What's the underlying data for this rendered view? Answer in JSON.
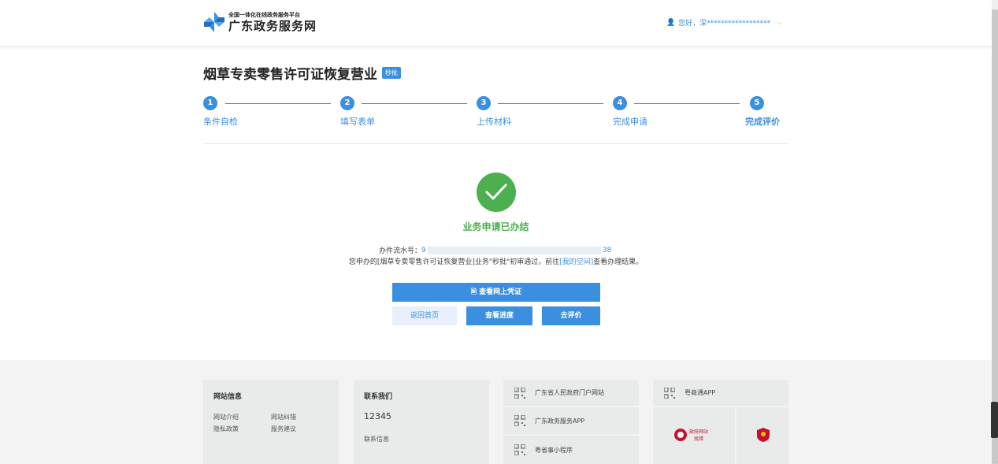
{
  "header": {
    "logo_small": "全国一体化在线政务服务平台",
    "logo_big": "广东政务服务网",
    "user_greeting": "您好，深******************"
  },
  "page": {
    "title": "烟草专卖零售许可证恢复营业",
    "badge": "秒批"
  },
  "steps": [
    {
      "num": "1",
      "label": "条件自检"
    },
    {
      "num": "2",
      "label": "填写表单"
    },
    {
      "num": "3",
      "label": "上传材料"
    },
    {
      "num": "4",
      "label": "完成申请"
    },
    {
      "num": "5",
      "label": "完成评价"
    }
  ],
  "result": {
    "status": "业务申请已办结",
    "serial_label": "办件流水号：",
    "serial_start": "9",
    "serial_end": "38",
    "msg_prefix": "您申办的[烟草专卖零售许可证恢复营业]业务\"秒批\"初审通过，前往",
    "msg_link": "[我的空间]",
    "msg_suffix": "查看办理结果。"
  },
  "buttons": {
    "view_cert": "🖹 查看网上凭证",
    "home": "返回首页",
    "progress": "查看进度",
    "rate": "去评价"
  },
  "footer": {
    "site_info": {
      "title": "网站信息",
      "links": [
        "网站介绍",
        "网站纠错",
        "隐私政策",
        "服务建议"
      ]
    },
    "contact": {
      "title": "联系我们",
      "phone": "12345",
      "info": "联系信息"
    },
    "qr_items": [
      "广东省人民政府门户网站",
      "广东政务服务APP",
      "粤省事小程序",
      "粤商通APP"
    ],
    "badge_text": "政府网站\n找错"
  },
  "colors": {
    "accent": "#3b8fe0",
    "success": "#4caf50"
  }
}
